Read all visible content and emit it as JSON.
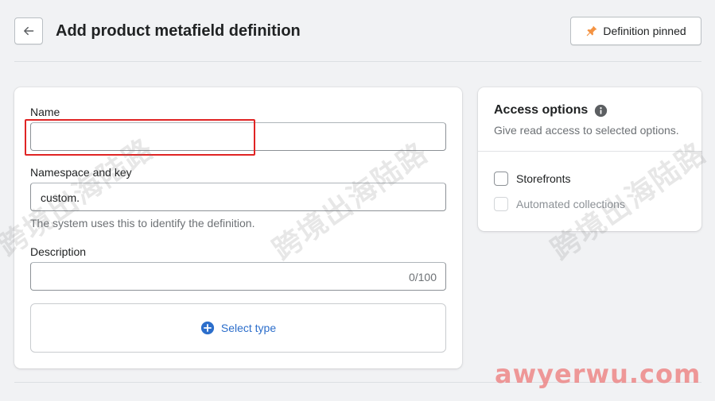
{
  "header": {
    "title": "Add product metafield definition",
    "pin_label": "Definition pinned"
  },
  "form": {
    "name_label": "Name",
    "name_value": "",
    "namespace_label": "Namespace and key",
    "namespace_prefix": "custom.",
    "namespace_help": "The system uses this to identify the definition.",
    "description_label": "Description",
    "description_count": "0/100",
    "select_type_label": "Select type"
  },
  "access": {
    "title": "Access options",
    "subtitle": "Give read access to selected options.",
    "options": [
      {
        "label": "Storefronts",
        "checked": false,
        "disabled": false
      },
      {
        "label": "Automated collections",
        "checked": false,
        "disabled": true
      }
    ]
  },
  "watermark": {
    "text": "跨境出海陆路",
    "site": "awyerwu.com"
  },
  "colors": {
    "accent": "#2c6ecb",
    "pin": "#f49342",
    "highlight": "#e02424"
  }
}
